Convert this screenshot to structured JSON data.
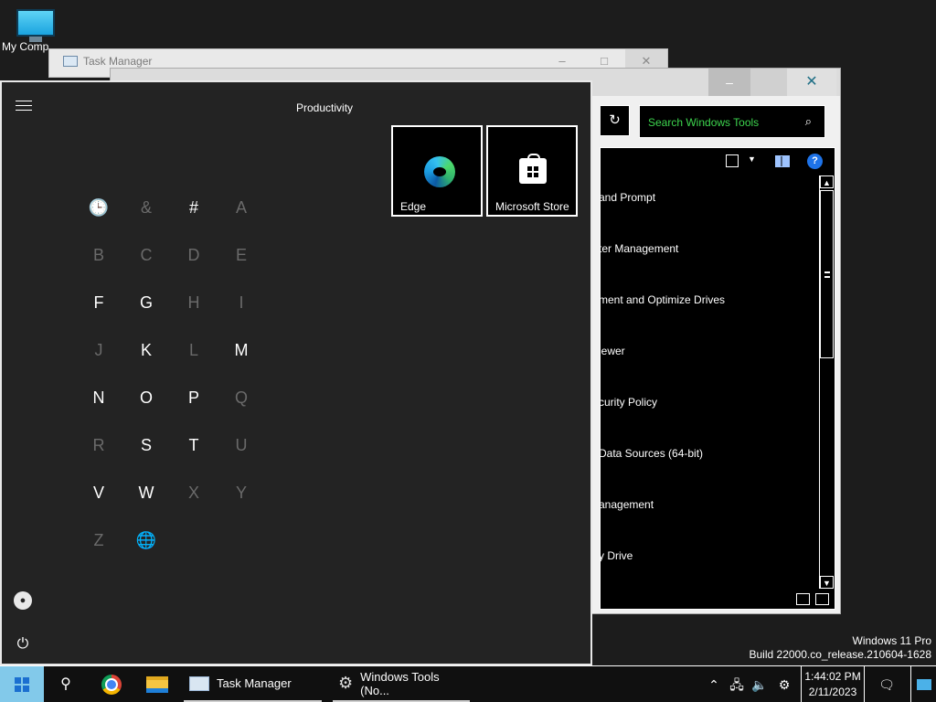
{
  "desktop": {
    "icon_label": "My Comp"
  },
  "task_manager_window": {
    "title": "Task Manager",
    "minimize": "–",
    "maximize": "□",
    "close": "✕"
  },
  "windows_tools_window": {
    "minimize": "–",
    "close": "✕",
    "refresh": "↻",
    "search_placeholder": "Search Windows Tools",
    "items": [
      "and Prompt",
      "ter Management",
      "ment and Optimize Drives",
      "iewer",
      "curity Policy",
      "Data Sources (64-bit)",
      "anagement",
      "y Drive"
    ]
  },
  "os_info": {
    "edition": "Windows 11 Pro",
    "build": "Build 22000.co_release.210604-1628"
  },
  "start_menu": {
    "group_label": "Productivity",
    "tiles": [
      {
        "label": "Edge"
      },
      {
        "label": "Microsoft Store"
      }
    ],
    "letters": [
      {
        "char": "🕒",
        "enabled": true
      },
      {
        "char": "&",
        "enabled": false
      },
      {
        "char": "#",
        "enabled": true
      },
      {
        "char": "A",
        "enabled": false
      },
      {
        "char": "B",
        "enabled": false
      },
      {
        "char": "C",
        "enabled": false
      },
      {
        "char": "D",
        "enabled": false
      },
      {
        "char": "E",
        "enabled": false
      },
      {
        "char": "F",
        "enabled": true
      },
      {
        "char": "G",
        "enabled": true
      },
      {
        "char": "H",
        "enabled": false
      },
      {
        "char": "I",
        "enabled": false
      },
      {
        "char": "J",
        "enabled": false
      },
      {
        "char": "K",
        "enabled": true
      },
      {
        "char": "L",
        "enabled": false
      },
      {
        "char": "M",
        "enabled": true
      },
      {
        "char": "N",
        "enabled": true
      },
      {
        "char": "O",
        "enabled": true
      },
      {
        "char": "P",
        "enabled": true
      },
      {
        "char": "Q",
        "enabled": false
      },
      {
        "char": "R",
        "enabled": false
      },
      {
        "char": "S",
        "enabled": true
      },
      {
        "char": "T",
        "enabled": true
      },
      {
        "char": "U",
        "enabled": false
      },
      {
        "char": "V",
        "enabled": true
      },
      {
        "char": "W",
        "enabled": true
      },
      {
        "char": "X",
        "enabled": false
      },
      {
        "char": "Y",
        "enabled": false
      },
      {
        "char": "Z",
        "enabled": false
      },
      {
        "char": "🌐",
        "enabled": false
      }
    ]
  },
  "taskbar": {
    "apps": [
      {
        "label": "Task Manager"
      },
      {
        "label": "Windows Tools (No..."
      }
    ],
    "clock": {
      "time": "1:44:02 PM",
      "date": "2/11/2023"
    }
  }
}
